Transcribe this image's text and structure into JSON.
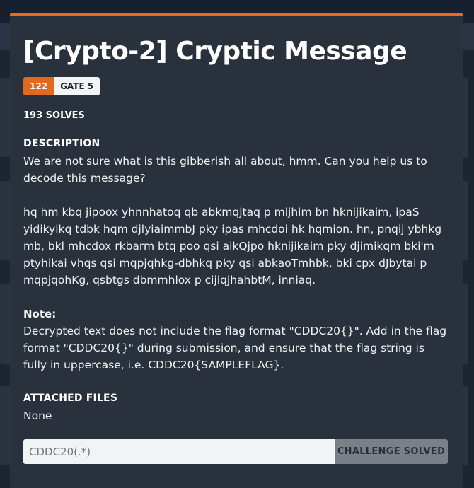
{
  "modal": {
    "title": "[Crypto-2] Cryptic Message",
    "points": "122",
    "gate": "GATE 5",
    "solves": "193 SOLVES",
    "description_label": "DESCRIPTION",
    "description": "We are not sure what is this gibberish all about, hmm. Can you help us to decode this message?",
    "ciphertext": "hq hm kbq jipoox yhnnhatoq qb abkmqjtaq p mijhim bn hknijikaim, ipaS yidikyikq tdbk hqm djlyiaimmbJ pky ipas mhcdoi hk hqmion. hn, pnqij ybhkg mb, bkl mhcdox rkbarm btq poo qsi aikQjpo hknijikaim pky djimikqm bki'm ptyhikai vhqs qsi mqpjqhkg-dbhkq pky qsi abkaoTmhbk, bki cpx dJbytai p mqpjqohKg, qsbtgs dbmmhlox p cijiqjhahbtM, inniaq.",
    "note_label": "Note:",
    "note": "Decrypted text does not include the flag format \"CDDC20{}\". Add in the flag format \"CDDC20{}\" during submission, and ensure that the flag string is fully in uppercase, i.e. CDDC20{SAMPLEFLAG}.",
    "files_label": "ATTACHED FILES",
    "files_value": "None",
    "flag_placeholder": "CDDC20(.*)",
    "submit_label": "CHALLENGE SOLVED"
  },
  "colors": {
    "accent": "#e86a1d",
    "modal_bg": "#28313c",
    "page_bg": "#1d2530"
  }
}
